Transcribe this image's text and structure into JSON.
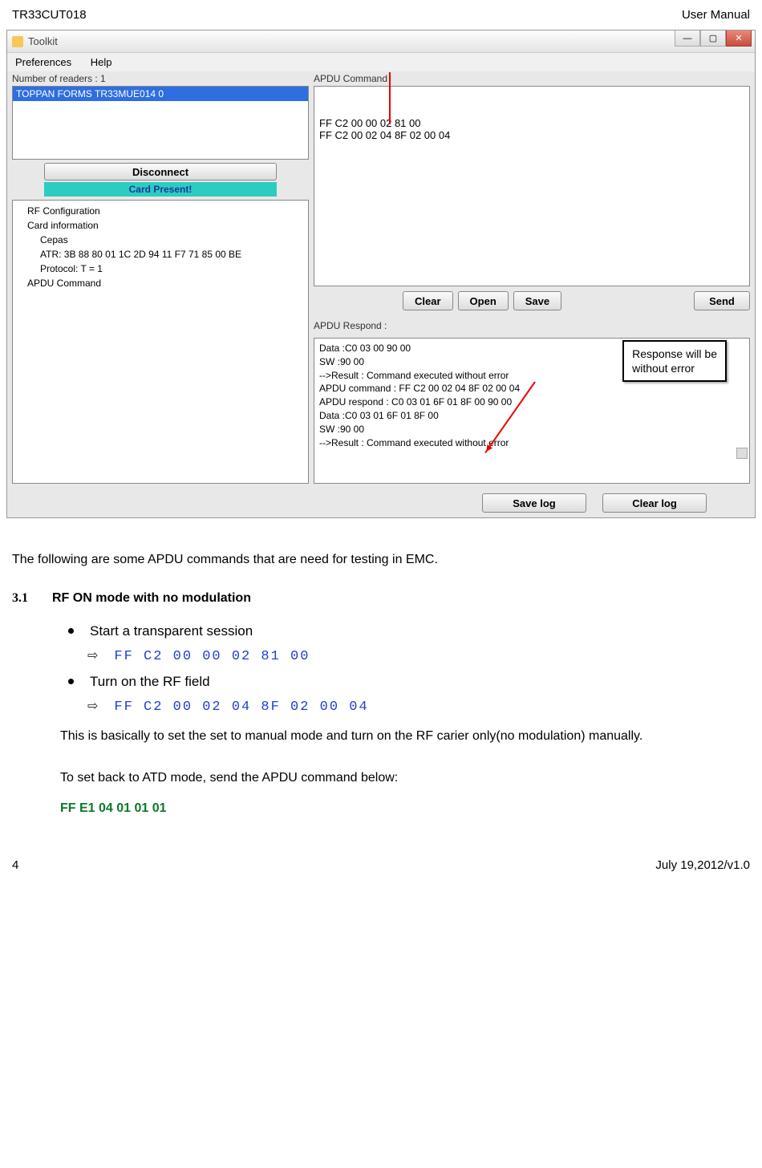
{
  "header": {
    "doc_id": "TR33CUT018",
    "doc_label": "User Manual"
  },
  "window": {
    "title": "Toolkit",
    "menu": {
      "preferences": "Preferences",
      "help": "Help"
    },
    "readers_label": "Number of readers : 1",
    "reader_selected": "TOPPAN FORMS TR33MUE014 0",
    "disconnect": "Disconnect",
    "card_present": "Card Present!",
    "tree": {
      "rf_config": "RF Configuration",
      "card_info": "Card information",
      "cepas": "Cepas",
      "atr": "ATR: 3B 88 80 01 1C 2D 94 11 F7 71 85 00 BE",
      "protocol": "Protocol: T = 1",
      "apdu_cmd": "APDU Command"
    },
    "apdu_cmd_label": "APDU Command",
    "apdu_cmds": [
      "FF C2 00 00 02 81 00",
      "FF C2 00 02 04 8F 02 00 04"
    ],
    "buttons": {
      "clear": "Clear",
      "open": "Open",
      "save": "Save",
      "send": "Send"
    },
    "apdu_resp_label": "APDU Respond :",
    "resp_lines": [
      "  Data :C0 03 00 90 00",
      "  SW  :90 00",
      "-->Result : Command executed without error",
      "",
      "APDU command : FF C2 00 02 04 8F 02 00 04",
      "APDU respond : C0 03 01 6F 01 8F 00 90 00",
      "  Data :C0 03 01 6F 01 8F 00",
      "  SW  :90 00",
      "-->Result : Command executed without error"
    ],
    "callout": "Response will be\nwithout error",
    "save_log": "Save log",
    "clear_log": "Clear log"
  },
  "manual": {
    "intro": "The following are some APDU commands that are need for testing in EMC.",
    "sec_num": "3.1",
    "sec_title": "RF ON mode with no modulation",
    "bullet1": "Start a transparent session",
    "cmd1": "FF C2 00 00 02 81 00",
    "bullet2": "Turn on the RF field",
    "cmd2": "FF C2 00 02 04 8F 02 00 04",
    "para1": "This is basically to set the set to manual mode and turn on the RF carier only(no modulation) manually.",
    "para2": "To set back to ATD mode, send the APDU command below:",
    "green_cmd": "FF E1 04 01 01 01"
  },
  "footer": {
    "page": "4",
    "version": "July 19,2012/v1.0"
  }
}
